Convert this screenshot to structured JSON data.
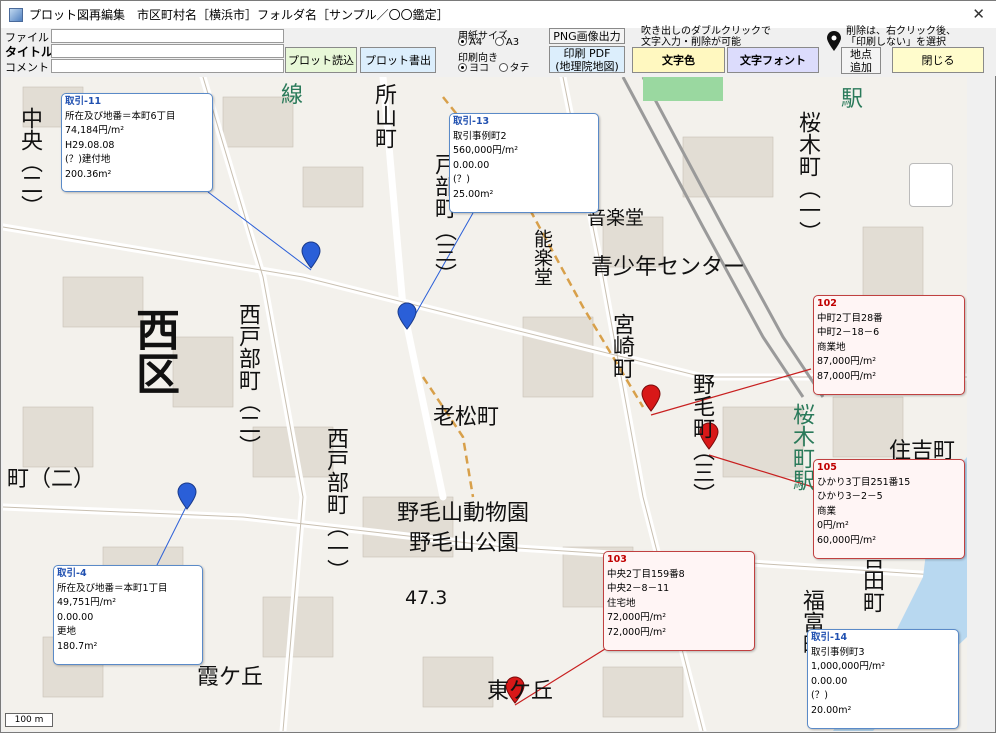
{
  "window": {
    "title": "プロット図再編集　市区町村名［横浜市］フォルダ名［サンプル／〇〇鑑定］",
    "close_glyph": "✕"
  },
  "toolbar": {
    "file_label": "ファイル",
    "title_label": "タイトル",
    "comment_label": "コメント",
    "plot_read": "プロット読込",
    "plot_write": "プロット書出",
    "paper_size_label": "用紙サイズ",
    "paper_a4": "A4",
    "paper_a3": "A3",
    "orientation_label": "印刷向き",
    "orient_landscape": "ヨコ",
    "orient_portrait": "タテ",
    "png_export": "PNG画像出力",
    "pdf_line1": "印刷 PDF",
    "pdf_line2": "(地理院地図)",
    "hint_line1": "吹き出しのダブルクリックで",
    "hint_line2": "文字入力・削除が可能",
    "text_color": "文字色",
    "text_font": "文字フォント",
    "delete_hint_line1": "削除は、右クリック後、",
    "delete_hint_line2": "「印刷しない」を選択",
    "add_point_line1": "地点",
    "add_point_line2": "追加",
    "close": "閉じる"
  },
  "map": {
    "scale_label": "100 m",
    "places": [
      {
        "text": "西区",
        "cls": "big v"
      },
      {
        "text": "中央（二）",
        "cls": "md v"
      },
      {
        "text": "所山町",
        "cls": "md v"
      },
      {
        "text": "戸部町（三）",
        "cls": "md v"
      },
      {
        "text": "能楽堂",
        "cls": "sm v"
      },
      {
        "text": "音楽堂",
        "cls": "sm"
      },
      {
        "text": "青少年センター",
        "cls": "md"
      },
      {
        "text": "桜木町（一）",
        "cls": "md v"
      },
      {
        "text": "西戸部町（二）",
        "cls": "md v"
      },
      {
        "text": "宮崎町",
        "cls": "md v"
      },
      {
        "text": "野毛町（三）",
        "cls": "md v"
      },
      {
        "text": "老松町",
        "cls": "md"
      },
      {
        "text": "西戸部町（一）",
        "cls": "md v"
      },
      {
        "text": "野毛山動物園",
        "cls": "md"
      },
      {
        "text": "野毛山公園",
        "cls": "md"
      },
      {
        "text": "霞ケ丘",
        "cls": "md"
      },
      {
        "text": "東ケ丘",
        "cls": "md"
      },
      {
        "text": "町（二）",
        "cls": "md"
      },
      {
        "text": "桜木町駅",
        "cls": "md v green"
      },
      {
        "text": "住吉町",
        "cls": "md"
      },
      {
        "text": "福富町",
        "cls": "md v"
      },
      {
        "text": "吉田町",
        "cls": "md v"
      },
      {
        "text": "47.3",
        "cls": "sm"
      },
      {
        "text": "駅",
        "cls": "md green"
      },
      {
        "text": "線",
        "cls": "md green"
      }
    ],
    "callouts": [
      {
        "id": "取引-11",
        "style": "blue",
        "lines": [
          "所在及び地番＝本町6丁目",
          "74,184円/m²",
          "H29.08.08",
          "(？)建付地",
          "200.36m²"
        ]
      },
      {
        "id": "取引-13",
        "style": "blue",
        "lines": [
          "取引事例町2",
          "560,000円/m²",
          "0.00.00",
          "(？)",
          "25.00m²"
        ]
      },
      {
        "id": "102",
        "style": "red",
        "lines": [
          "中町2丁目28番",
          "中町2－18－6",
          "商業地",
          "87,000円/m²",
          "87,000円/m²"
        ]
      },
      {
        "id": "105",
        "style": "red",
        "lines": [
          "ひかり3丁目251番15",
          "ひかり3－2－5",
          "商業",
          "0円/m²",
          "60,000円/m²"
        ]
      },
      {
        "id": "103",
        "style": "red",
        "lines": [
          "中央2丁目159番8",
          "中央2－8－11",
          "住宅地",
          "72,000円/m²",
          "72,000円/m²"
        ]
      },
      {
        "id": "取引-4",
        "style": "blue",
        "lines": [
          "所在及び地番＝本町1丁目",
          "49,751円/m²",
          "0.00.00",
          "更地",
          "180.7m²"
        ]
      },
      {
        "id": "取引-14",
        "style": "blue",
        "lines": [
          "取引事例町3",
          "1,000,000円/m²",
          "0.00.00",
          "(？)",
          "20.00m²"
        ]
      }
    ]
  },
  "colors": {
    "blue_pin": "#2a5fd8",
    "red_pin": "#d81818",
    "callout_blue_border": "#5a8ac8",
    "callout_red_border": "#c04040"
  }
}
